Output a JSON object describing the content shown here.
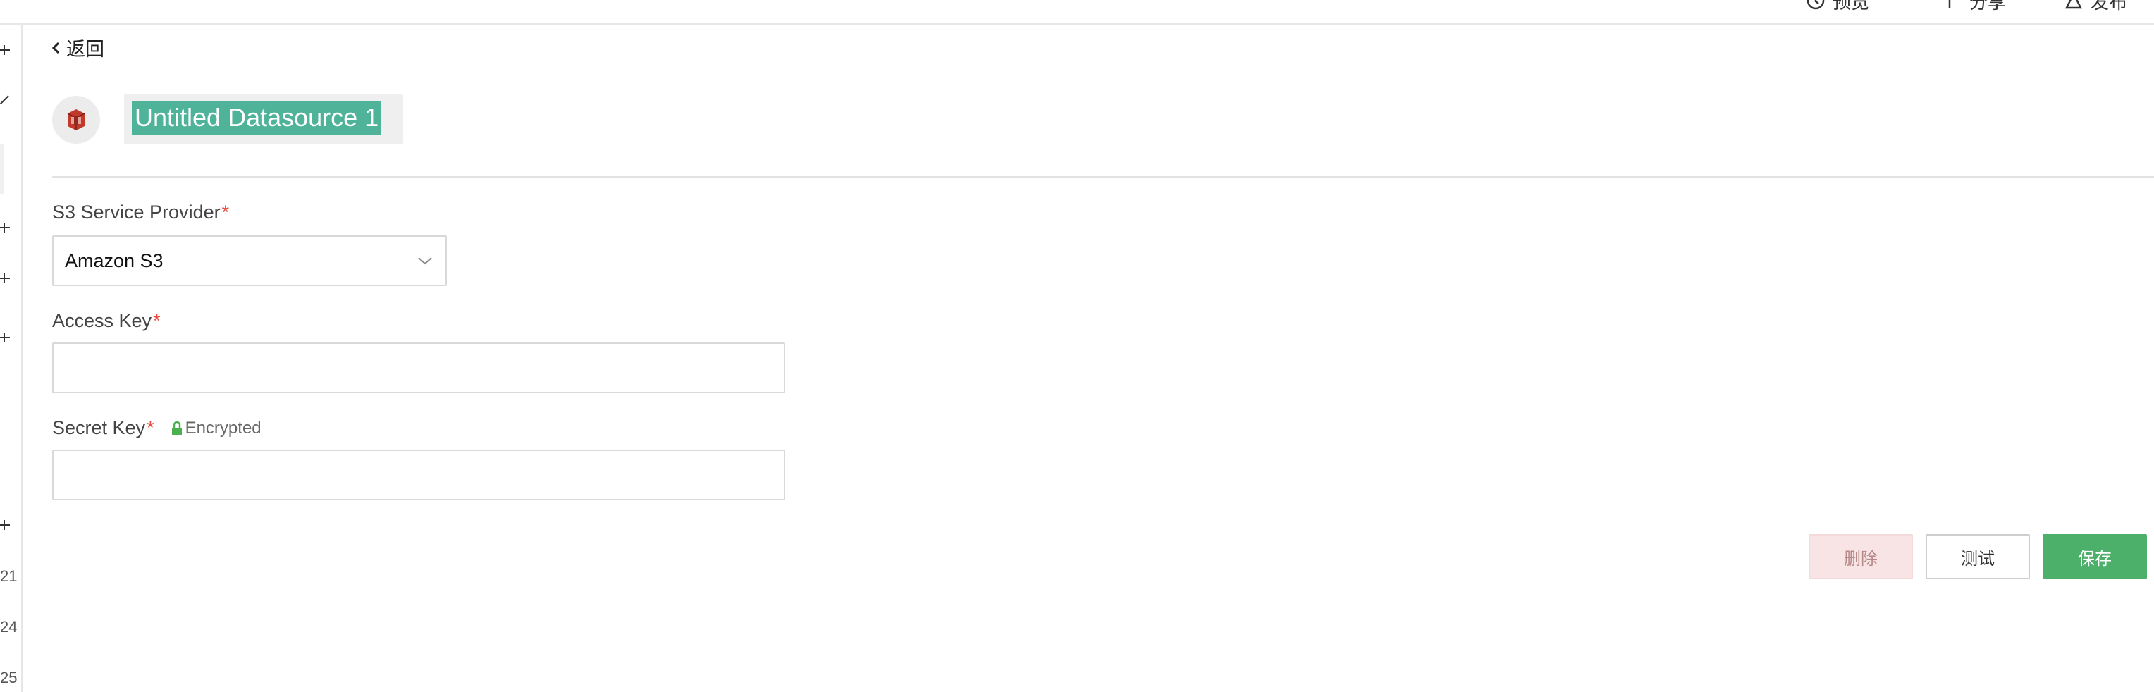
{
  "header": {
    "actions": [
      {
        "name": "preview",
        "label": "预览",
        "icon": "preview-icon"
      },
      {
        "name": "share",
        "label": "分享",
        "icon": "share-icon"
      },
      {
        "name": "deploy",
        "label": "发布",
        "icon": "deploy-icon"
      }
    ]
  },
  "sidebar": {
    "numbers": [
      "21",
      "24",
      "25"
    ]
  },
  "nav": {
    "back_label": "返回"
  },
  "datasource": {
    "icon": "amazon-s3-icon",
    "title": "Untitled Datasource 1"
  },
  "form": {
    "provider": {
      "label": "S3 Service Provider",
      "required": "*",
      "value": "Amazon S3"
    },
    "access_key": {
      "label": "Access Key",
      "required": "*",
      "value": "",
      "placeholder": ""
    },
    "secret_key": {
      "label": "Secret Key",
      "required": "*",
      "value": "",
      "placeholder": "",
      "badge": "Encrypted"
    }
  },
  "buttons": {
    "delete": "删除",
    "test": "测试",
    "save": "保存"
  },
  "colors": {
    "accent_green": "#4caf6a",
    "title_highlight": "#4fb399",
    "required_red": "#e5483d",
    "delete_bg": "#f8e4e4",
    "lock_green": "#4caf50"
  }
}
